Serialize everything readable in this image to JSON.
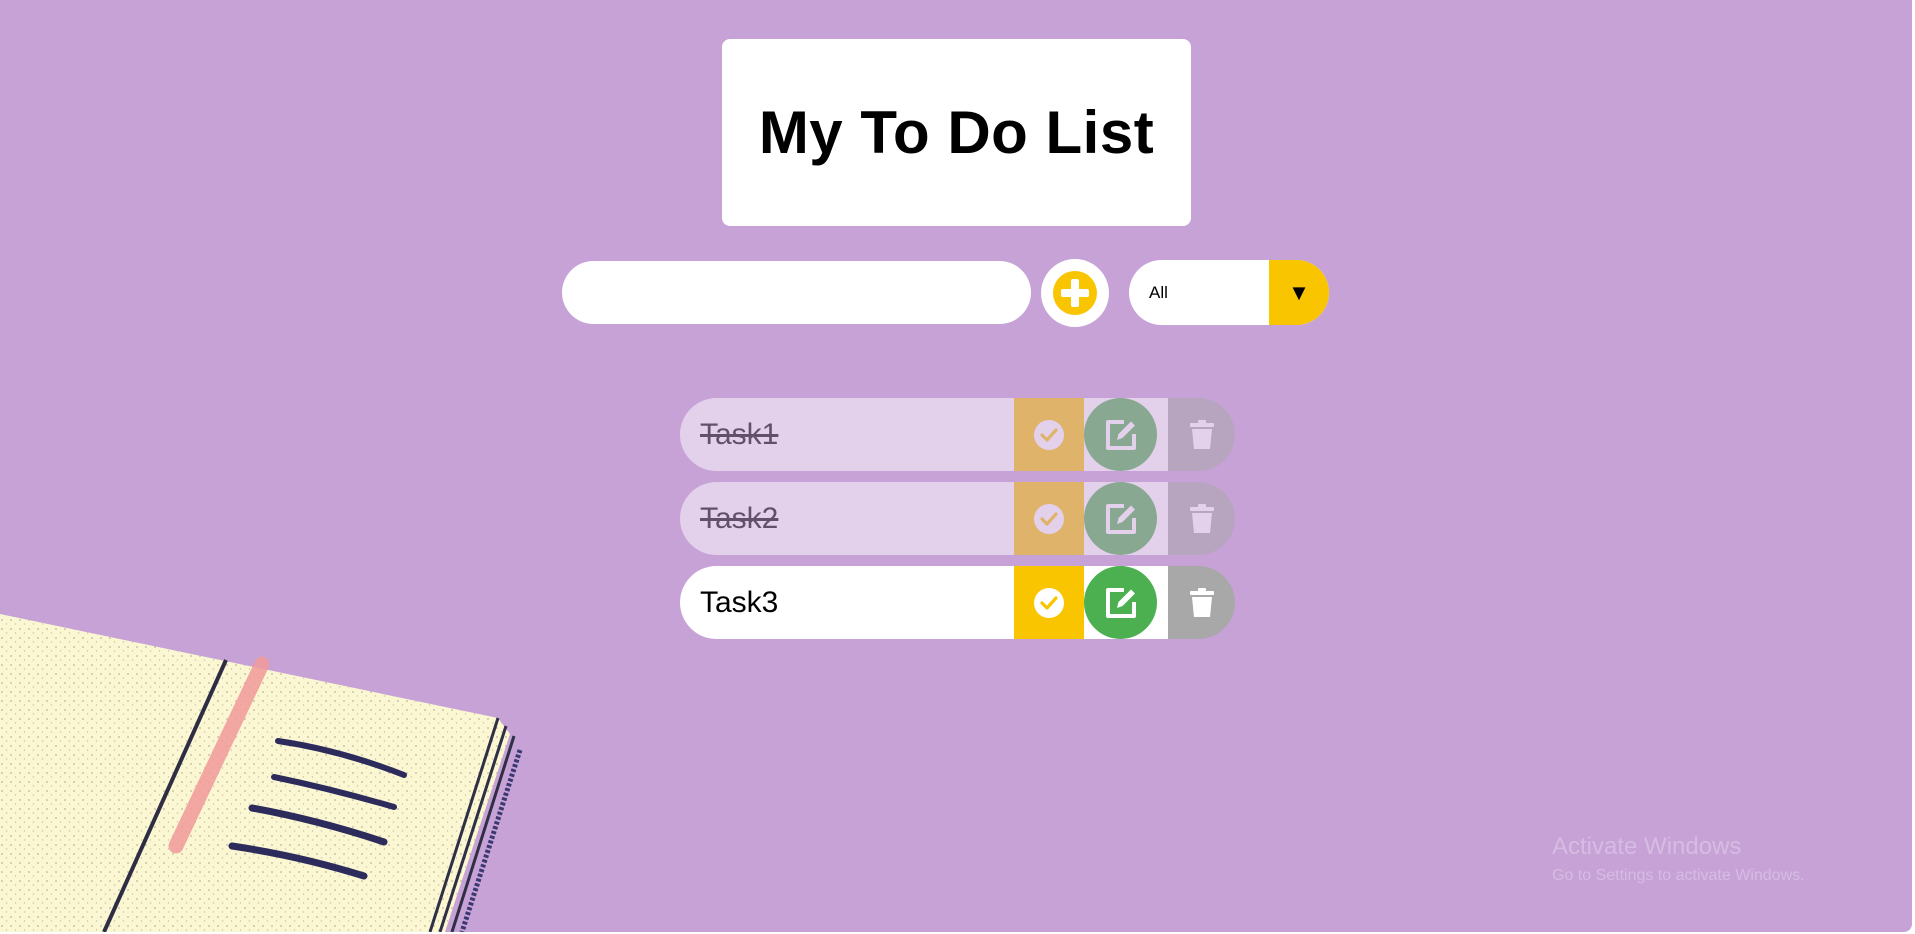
{
  "app": {
    "title": "My To Do List"
  },
  "input": {
    "value": "",
    "placeholder": ""
  },
  "filter": {
    "selected": "All",
    "arrow": "▼"
  },
  "tasks": [
    {
      "text": "Task1",
      "completed": true
    },
    {
      "text": "Task2",
      "completed": true
    },
    {
      "text": "Task3",
      "completed": false
    }
  ],
  "icons": {
    "add": "plus-circle-icon",
    "check": "check-circle-icon",
    "edit": "edit-icon",
    "delete": "trash-icon"
  },
  "colors": {
    "background": "#c7a2d7",
    "accent": "#f9c500",
    "edit": "#4caf50",
    "delete": "#a8a8a8",
    "card": "#ffffff"
  },
  "watermark": {
    "title": "Activate Windows",
    "subtitle": "Go to Settings to activate Windows."
  }
}
